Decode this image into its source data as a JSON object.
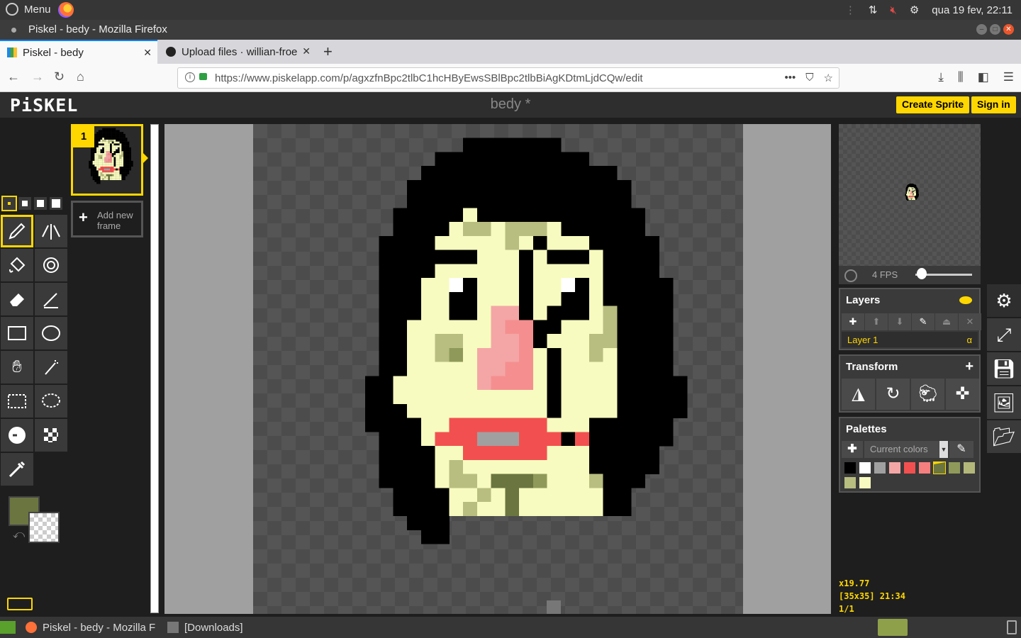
{
  "os": {
    "menu_label": "Menu",
    "datetime": "qua 19 fev, 22:11"
  },
  "window": {
    "title": "Piskel - bedy - Mozilla Firefox"
  },
  "browser": {
    "tabs": [
      {
        "label": "Piskel - bedy",
        "active": true
      },
      {
        "label": "Upload files · willian-froe",
        "active": false
      }
    ],
    "url": "https://www.piskelapp.com/p/agxzfnBpc2tlbC1hcHByEwsSBlBpc2tlbBiAgKDtmLjdCQw/edit",
    "url_actions": [
      "•••",
      "⛉",
      "☆"
    ]
  },
  "piskel": {
    "logo": "PiSKEL",
    "doc_title": "bedy *",
    "create_sprite": "Create Sprite",
    "sign_in": "Sign in",
    "frame_number": "1",
    "add_frame": "Add new frame",
    "fps": "4 FPS",
    "fps_value": 4,
    "layers_title": "Layers",
    "layer_name": "Layer 1",
    "layer_alpha": "α",
    "transform_title": "Transform",
    "palettes_title": "Palettes",
    "palette_name": "Current colors",
    "palette_colors": [
      "#000000",
      "#ffffff",
      "#a0a0a0",
      "#f4a6a6",
      "#f25050",
      "#f57f7f",
      "#6b7540",
      "#8f9a5a",
      "#b3b87a",
      "#b8bd80",
      "#f8fbbf"
    ],
    "selected_palette_index": 6,
    "primary_color": "#6b7540",
    "secondary_color": "transparent",
    "zoom": "x19.77",
    "size_cursor": "[35x35] 21:34",
    "frame_index": "1/1",
    "sprite": {
      "width": 35,
      "height": 35,
      "palette": {
        "K": "#000000",
        "W": "#ffffff",
        "Y": "#f8fbbf",
        "O": "#b8bd80",
        "D": "#8f9a5a",
        "E": "#6b7540",
        "P": "#f4a6a6",
        "Q": "#f58f8f",
        "R": "#f25050",
        "G": "#a0a0a0"
      },
      "rows": [
        ".................................",
        "..............KKKKKKK............",
        "............KKKKKKKKKKK..........",
        "...........KKKKKKKKKKKKKK........",
        "..........KKKKKKKKKKKKKKKK.......",
        "..........KKKKKKKKKKKKKKKK.......",
        ".........KKKKKYKKKKKKKKKKKK......",
        ".........KKKKYOOYOOOYKKKKKK......",
        "........KKKKYYYYYOYKYYYKKKKK.....",
        "........KKKKKKKYYYKYKKKYKKKK.....",
        "........KKKKYYYYYYKYYYYYKKKK.....",
        "........KKKYYWKYYYKYYWKYKKKKK....",
        "........KKKYYKKYYYKYYKKYKKKKK....",
        "........KKKYYKKYPPKYKKKYOKKKK....",
        "........KKYYYYYYPQQKKYYYOKKKK....",
        "........KKYYOOYYPPQKYYYOOKKKK....",
        "........KKYYODYPPPQYKYYOYKKKK....",
        "........KKYYYYYPPQQYKYYYYKKKK....",
        ".......KKYYYYYYPQQQYKYYYYKKKKK...",
        ".......KKYYYYYYYYYYYKYYYYKKKKK...",
        ".......KKKYYYYYYYYYYKYYYYKKKKK...",
        ".......KKKKYYRRRRRRRYYYKKKKKK....",
        "........KKKYRRRGGGRRRKRKKKKKK....",
        "........KKKKYYRRRRRRYYYKKKKK.....",
        "........KKKKYOYYYYYYYYYKKKKK.....",
        "........KKKKYOOYEEEDYYYOKKK......",
        ".........KKKKYYOYEYYYYYYKK.......",
        ".........KKKKYOYYEYYYYYYKK.......",
        "..........KKK..............",
        "...........KK..............",
        ".................................",
        ".................................",
        ".................................",
        "................................."
      ]
    }
  }
}
